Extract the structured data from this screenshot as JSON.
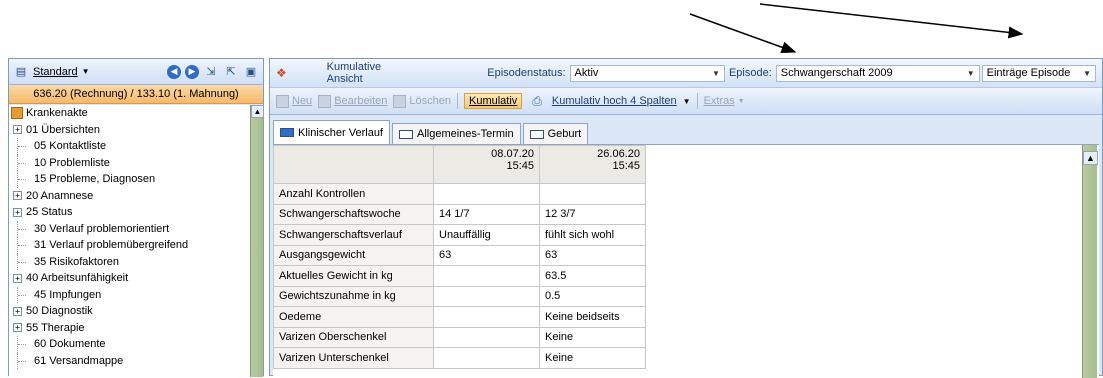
{
  "left_panel": {
    "standard_label": "Standard",
    "amount_text": "636.20 (Rechnung) / 133.10 (1. Mahnung)",
    "tree": [
      {
        "label": "Krankenakte",
        "type": "root"
      },
      {
        "label": "01 Übersichten",
        "type": "expandable"
      },
      {
        "label": "05 Kontaktliste",
        "type": "leaf"
      },
      {
        "label": "10 Problemliste",
        "type": "leaf"
      },
      {
        "label": "15 Probleme, Diagnosen",
        "type": "leaf"
      },
      {
        "label": "20 Anamnese",
        "type": "expandable"
      },
      {
        "label": "25 Status",
        "type": "expandable"
      },
      {
        "label": "30 Verlauf problemorientiert",
        "type": "leaf"
      },
      {
        "label": "31 Verlauf problemübergreifend",
        "type": "leaf"
      },
      {
        "label": "35 Risikofaktoren",
        "type": "leaf"
      },
      {
        "label": "40 Arbeitsunfähigkeit",
        "type": "expandable"
      },
      {
        "label": "45 Impfungen",
        "type": "leaf"
      },
      {
        "label": "50 Diagnostik",
        "type": "expandable"
      },
      {
        "label": "55 Therapie",
        "type": "expandable"
      },
      {
        "label": "60 Dokumente",
        "type": "leaf"
      },
      {
        "label": "61 Versandmappe",
        "type": "leaf"
      }
    ]
  },
  "right_panel": {
    "view_title": "Kumulative Ansicht",
    "episode_status_label": "Episodenstatus:",
    "episode_status_value": "Aktiv",
    "episode_label": "Episode:",
    "episode_value": "Schwangerschaft 2009",
    "entries_value": "Einträge Episode",
    "toolbar": {
      "new": "Neu",
      "edit": "Bearbeiten",
      "delete": "Löschen",
      "cumulative": "Kumulativ",
      "cumulative_4": "Kumulativ hoch 4 Spalten",
      "extras": "Extras"
    },
    "tabs": [
      "Klinischer Verlauf",
      "Allgemeines-Termin",
      "Geburt"
    ],
    "table": {
      "columns": [
        {
          "date": "08.07.20",
          "time": "15:45"
        },
        {
          "date": "26.06.20",
          "time": "15:45"
        }
      ],
      "rows": [
        {
          "label": "Anzahl Kontrollen",
          "values": [
            "",
            ""
          ]
        },
        {
          "label": "Schwangerschaftswoche",
          "values": [
            "14 1/7",
            "12 3/7"
          ]
        },
        {
          "label": "Schwangerschaftsverlauf",
          "values": [
            "Unauffällig",
            "fühlt sich wohl"
          ]
        },
        {
          "label": "Ausgangsgewicht",
          "values": [
            "63",
            "63"
          ]
        },
        {
          "label": "Aktuelles Gewicht  in kg",
          "values": [
            "",
            "63.5"
          ]
        },
        {
          "label": "Gewichtszunahme in kg",
          "values": [
            "",
            "0.5"
          ]
        },
        {
          "label": "Oedeme",
          "values": [
            "",
            "Keine beidseits"
          ]
        },
        {
          "label": "Varizen Oberschenkel",
          "values": [
            "",
            "Keine"
          ]
        },
        {
          "label": "Varizen Unterschenkel",
          "values": [
            "",
            "Keine"
          ]
        }
      ]
    }
  },
  "colors": {
    "accent_blue": "#2f6dc9",
    "amount_orange": "#f6b96a",
    "scrollbar_green": "#a5bd8b"
  }
}
